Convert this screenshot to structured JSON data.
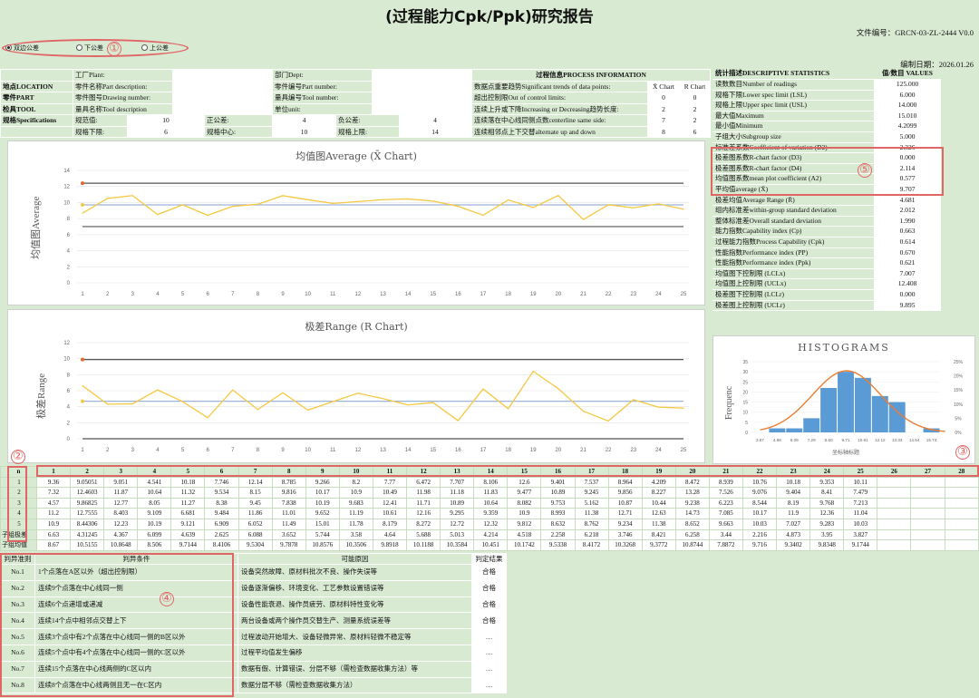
{
  "title": "(过程能力Cpk/Ppk)研究报告",
  "doc_no": "文件编号：GRCN-03-ZL-2444 V0.0",
  "edit_date": "编制日期：2026.01.26",
  "tolerance_options": [
    {
      "label": "双边公差",
      "selected": true
    },
    {
      "label": "下公差",
      "selected": false
    },
    {
      "label": "上公差",
      "selected": false
    }
  ],
  "markers": [
    "①",
    "②",
    "③",
    "④",
    "⑤"
  ],
  "info": {
    "location": "地点LOCATION",
    "part": "零件PART",
    "tool": "检具TOOL",
    "spec": "规格Specifications",
    "factory": "工厂Plant:",
    "part_desc": "零件名称Part description:",
    "drawing_no": "零件图号Drawing number:",
    "tool_desc": "量具名称Tool description",
    "dept": "部门Dept:",
    "part_no": "零件编号Part number:",
    "tool_no": "量具编号Tool number:",
    "unit": "单位unit:",
    "spec_value_label": "规范值:",
    "spec_value": "10",
    "pos_tol_label": "正公差:",
    "pos_tol": "4",
    "neg_tol_label": "负公差:",
    "neg_tol": "4",
    "lsl_label": "规格下限:",
    "lsl": "6",
    "center_label": "规格中心:",
    "center": "10",
    "usl_label": "规格上限:",
    "usl": "14"
  },
  "process": {
    "title": "过程信息PROCESS  INFORMATION",
    "col1": "X̄ Chart",
    "col2": "R Chart",
    "rows": [
      {
        "label": "数据点重要趋势Significant trends of data points:",
        "x": "",
        "r": ""
      },
      {
        "label": "超出控制限Out of control limits:",
        "x": "0",
        "r": "0"
      },
      {
        "label": "连续上升或下降Increasing or Decreasing趋势长度:",
        "x": "2",
        "r": "2"
      },
      {
        "label": "连续落在中心线同侧点数centerline same side:",
        "x": "7",
        "r": "2"
      },
      {
        "label": "连续相邻点上下交替alternate up and down",
        "x": "8",
        "r": "6"
      }
    ]
  },
  "stats": {
    "title": "统计描述DESCRIPTIVE STATISTICS",
    "value_title": "值/数目 VALUES",
    "rows": [
      [
        "读数数目Number of readings",
        "125.000"
      ],
      [
        "规格下限Lower spec limit (LSL)",
        "6.000"
      ],
      [
        "规格上限Upper spec limit (USL)",
        "14.000"
      ],
      [
        "最大值Maximum",
        "15.010"
      ],
      [
        "最小值Minimum",
        "4.2099"
      ],
      [
        "子组大小Subgroup size",
        "5.000"
      ],
      [
        "标准差系数Coefficient of variation (D2)",
        "2.326"
      ],
      [
        "极差图系数R-chart factor (D3)",
        "0.000"
      ],
      [
        "极差图系数R-chart factor (D4)",
        "2.114"
      ],
      [
        "均值图系数mean plot coefficient (A2)",
        "0.577"
      ],
      [
        "平均值average (X̄)",
        "9.707"
      ],
      [
        "极差均值Average Range (R̄)",
        "4.681"
      ],
      [
        "组内标准差within-group standard deviation",
        "2.012"
      ],
      [
        "整体标准差Overall standard deviation",
        "1.990"
      ],
      [
        "能力指数Capability index (Cp)",
        "0.663"
      ],
      [
        "过程能力指数Process Capability (Cpk)",
        "0.614"
      ],
      [
        "性能指数Performance index (PP)",
        "0.670"
      ],
      [
        "性能指数Performance index (Ppk)",
        "0.621"
      ],
      [
        "均值图下控制限 (LCLx)",
        "7.007"
      ],
      [
        "均值图上控制限 (UCLx)",
        "12.408"
      ],
      [
        "极差图下控制限 (LCLr)",
        "0.000"
      ],
      [
        "极差图上控制限 (UCLr)",
        "9.895"
      ]
    ]
  },
  "chart_data": [
    {
      "type": "line",
      "title": "均值图Average (X̄  Chart)",
      "ylabel": "均值图Average",
      "categories": [
        "1",
        "2",
        "3",
        "4",
        "5",
        "6",
        "7",
        "8",
        "9",
        "10",
        "11",
        "12",
        "13",
        "14",
        "15",
        "16",
        "17",
        "18",
        "19",
        "20",
        "21",
        "22",
        "23",
        "24",
        "25"
      ],
      "ylim": [
        0,
        14
      ],
      "yticks": [
        "0",
        "2",
        "4",
        "6",
        "8",
        "10",
        "12",
        "14"
      ],
      "series": [
        {
          "values": [
            8.67,
            10.5155,
            10.8648,
            8.506,
            9.7144,
            8.4106,
            9.5304,
            9.7878,
            10.8576,
            10.3506,
            9.8918,
            10.1188,
            10.3584,
            10.451,
            10.1742,
            9.5338,
            8.4172,
            10.3268,
            9.3772,
            10.8744,
            7.8872,
            9.716,
            9.3402,
            9.8348,
            9.1744
          ],
          "color": "#f5c842"
        }
      ],
      "lines": [
        {
          "value": 12.408,
          "color": "#555"
        },
        {
          "value": 9.707,
          "color": "#9cb4d8"
        },
        {
          "value": 7.007,
          "color": "#555"
        }
      ],
      "marks": [
        {
          "x": "1",
          "y": 12.408,
          "color": "#e8652b"
        },
        {
          "x": "1",
          "y": 9.707,
          "color": "#f5c842"
        }
      ]
    },
    {
      "type": "line",
      "title": "极差Range (R Chart)",
      "ylabel": "极差Range",
      "categories": [
        "1",
        "2",
        "3",
        "4",
        "5",
        "6",
        "7",
        "8",
        "9",
        "10",
        "11",
        "12",
        "13",
        "14",
        "15",
        "16",
        "17",
        "18",
        "19",
        "20",
        "21",
        "22",
        "23",
        "24",
        "25"
      ],
      "ylim": [
        0,
        12
      ],
      "yticks": [
        "0",
        "2",
        "4",
        "6",
        "8",
        "10",
        "12"
      ],
      "series": [
        {
          "values": [
            6.63,
            4.31245,
            4.367,
            6.099,
            4.639,
            2.625,
            6.088,
            3.652,
            5.744,
            3.58,
            4.64,
            5.688,
            5.013,
            4.214,
            4.518,
            2.258,
            6.218,
            3.746,
            8.421,
            6.258,
            3.44,
            2.216,
            4.873,
            3.95,
            3.827
          ],
          "color": "#f5c842"
        }
      ],
      "lines": [
        {
          "value": 9.895,
          "color": "#555"
        },
        {
          "value": 4.681,
          "color": "#9cb4d8"
        },
        {
          "value": 0,
          "color": "#555"
        }
      ],
      "marks": [
        {
          "x": "1",
          "y": 9.895,
          "color": "#e8652b"
        },
        {
          "x": "1",
          "y": 4.681,
          "color": "#f5c842"
        }
      ]
    },
    {
      "type": "bar",
      "title": "HISTOGRAMS",
      "ylabel": "Frequenc",
      "xlabel": "坐标轴标题",
      "categories": [
        "3.67",
        "4.88",
        "6.09",
        "7.29",
        "8.50",
        "9.71",
        "10.91",
        "12.12",
        "13.33",
        "14.54",
        "15.74"
      ],
      "values": [
        0,
        2,
        2,
        7,
        22,
        30,
        27,
        18,
        15,
        0,
        2
      ],
      "ylim": [
        0,
        35
      ],
      "yticks": [
        "0",
        "5",
        "10",
        "15",
        "20",
        "25",
        "30",
        "35"
      ],
      "y2ticks": [
        "0%",
        "5%",
        "10%",
        "15%",
        "20%",
        "25%"
      ],
      "bar_color": "#5b9bd5",
      "curve_color": "#ed7d31"
    }
  ],
  "table": {
    "n_label": "n",
    "cols": [
      "1",
      "2",
      "3",
      "4",
      "5",
      "6",
      "7",
      "8",
      "9",
      "10",
      "11",
      "12",
      "13",
      "14",
      "15",
      "16",
      "17",
      "18",
      "19",
      "20",
      "21",
      "22",
      "23",
      "24",
      "25",
      "26",
      "27",
      "28"
    ],
    "rows": [
      {
        "label": "1",
        "values": [
          "9.36",
          "9.05051",
          "9.051",
          "4.541",
          "10.18",
          "7.746",
          "12.14",
          "8.785",
          "9.266",
          "8.2",
          "7.77",
          "6.472",
          "7.707",
          "8.106",
          "12.6",
          "9.401",
          "7.537",
          "8.964",
          "4.209",
          "8.472",
          "8.939",
          "10.76",
          "10.18",
          "9.353",
          "10.11",
          "",
          "",
          ""
        ]
      },
      {
        "label": "2",
        "values": [
          "7.32",
          "12.4603",
          "11.87",
          "10.64",
          "11.32",
          "9.534",
          "8.15",
          "9.816",
          "10.17",
          "10.9",
          "10.49",
          "11.98",
          "11.18",
          "11.83",
          "9.477",
          "10.89",
          "9.245",
          "9.856",
          "8.227",
          "13.28",
          "7.526",
          "9.076",
          "9.404",
          "8.41",
          "7.479",
          "",
          "",
          ""
        ]
      },
      {
        "label": "3",
        "values": [
          "4.57",
          "9.86825",
          "12.77",
          "8.05",
          "11.27",
          "8.38",
          "9.45",
          "7.838",
          "10.19",
          "9.683",
          "12.41",
          "11.71",
          "10.89",
          "10.64",
          "8.082",
          "9.753",
          "5.162",
          "10.87",
          "10.44",
          "9.238",
          "6.223",
          "8.544",
          "8.19",
          "9.768",
          "7.213",
          "",
          "",
          ""
        ]
      },
      {
        "label": "4",
        "values": [
          "11.2",
          "12.7555",
          "8.403",
          "9.109",
          "6.681",
          "9.484",
          "11.86",
          "11.01",
          "9.652",
          "11.19",
          "10.61",
          "12.16",
          "9.295",
          "9.359",
          "10.9",
          "8.993",
          "11.38",
          "12.71",
          "12.63",
          "14.73",
          "7.085",
          "10.17",
          "11.9",
          "12.36",
          "11.04",
          "",
          "",
          ""
        ]
      },
      {
        "label": "5",
        "values": [
          "10.9",
          "8.44306",
          "12.23",
          "10.19",
          "9.121",
          "6.909",
          "6.052",
          "11.49",
          "15.01",
          "11.78",
          "8.179",
          "8.272",
          "12.72",
          "12.32",
          "9.812",
          "8.632",
          "8.762",
          "9.234",
          "11.38",
          "8.652",
          "9.663",
          "10.03",
          "7.027",
          "9.283",
          "10.03",
          "",
          "",
          ""
        ]
      },
      {
        "label": "子组极差",
        "values": [
          "6.63",
          "4.31245",
          "4.367",
          "6.099",
          "4.639",
          "2.625",
          "6.088",
          "3.652",
          "5.744",
          "3.58",
          "4.64",
          "5.688",
          "5.013",
          "4.214",
          "4.518",
          "2.258",
          "6.218",
          "3.746",
          "8.421",
          "6.258",
          "3.44",
          "2.216",
          "4.873",
          "3.95",
          "3.827",
          "",
          "",
          ""
        ]
      },
      {
        "label": "子组均值",
        "values": [
          "8.67",
          "10.5155",
          "10.8648",
          "8.506",
          "9.7144",
          "8.4106",
          "9.5304",
          "9.7878",
          "10.8576",
          "10.3506",
          "9.8918",
          "10.1188",
          "10.3584",
          "10.451",
          "10.1742",
          "9.5338",
          "8.4172",
          "10.3268",
          "9.3772",
          "10.8744",
          "7.8872",
          "9.716",
          "9.3402",
          "9.8348",
          "9.1744",
          "",
          "",
          ""
        ]
      }
    ]
  },
  "rules": {
    "headers": [
      "判异准则",
      "判异条件",
      "可能原因",
      "判定结果"
    ],
    "rows": [
      [
        "No.1",
        "1个点落在A区以外（超出控制限）",
        "设备突然故障、原材料批次不良、操作失误等",
        "合格"
      ],
      [
        "No.2",
        "连续9个点落在中心线同一侧",
        "设备逐渐偏移、环境变化、工艺参数设置错误等",
        "合格"
      ],
      [
        "No.3",
        "连续6个点递增或递减",
        "设备性能衰退、操作员疲劳、原材料特性变化等",
        "合格"
      ],
      [
        "No.4",
        "连续14个点中相邻点交替上下",
        "两台设备或两个操作员交替生产、测量系统误差等",
        "合格"
      ],
      [
        "No.5",
        "连续3个点中有2个点落在中心线同一侧的B区以外",
        "过程波动开始增大、设备轻微异常、原材料轻微不稳定等",
        "…"
      ],
      [
        "No.6",
        "连续5个点中有4个点落在中心线同一侧的C区以外",
        "过程平均值发生偏移",
        "…"
      ],
      [
        "No.7",
        "连续15个点落在中心线两侧的C区以内",
        "数据有假、计算错误、分层不够（需检查数据收集方法）等",
        "…"
      ],
      [
        "No.8",
        "连续8个点落在中心线两侧且无一在C区内",
        "数据分层不够（需检查数据收集方法）",
        "…"
      ]
    ]
  }
}
